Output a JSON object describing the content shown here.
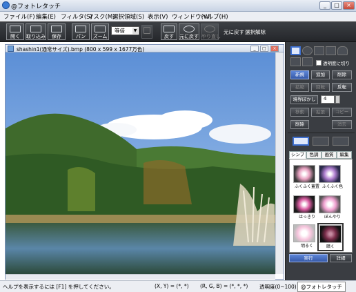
{
  "window": {
    "title": "@フォトレタッチ",
    "buttons": {
      "minimize": "_",
      "maximize": "□",
      "close": "×"
    }
  },
  "menubar": [
    "ファイル(F)",
    "編集(E)",
    "フィルタ(S)",
    "マスク(M)",
    "選択領域(S)",
    "表示(V)",
    "ウィンドウ(W)",
    "ヘルプ(H)"
  ],
  "toolbar": {
    "open": "開く",
    "import": "取り込み",
    "save": "保存",
    "pan": "パン",
    "zoom": "ズーム",
    "zoom_value": "等倍",
    "redo_fill": "戻す",
    "undo_redo": "元に戻す",
    "redo": "やり直し",
    "undo_text": "元に戻す",
    "deselect_text": "選択解除"
  },
  "canvas": {
    "title": "shashin1(通常サイズ).bmp (800 x 599 x 1677万色)"
  },
  "panel": {
    "transparency_label": "透明度に切り",
    "new_selection": "新規",
    "add_selection": "追加",
    "remove_selection": "削除",
    "btn_scale": "拡縮",
    "btn_rotate": "回転",
    "btn_invert": "反転",
    "feather_label": "境界ぼかし",
    "feather_value": "4",
    "btn_move": "移動",
    "btn_expand": "拡張",
    "btn_copy": "コピー",
    "btn_delete": "削除",
    "btn_clear": "消去"
  },
  "filters": {
    "tabs": [
      "シンプル",
      "色調",
      "画質",
      "編集"
    ],
    "items": [
      {
        "label": "ふくふく蓋置",
        "hue": "#e8a0c0"
      },
      {
        "label": "ふくふく色",
        "hue": "#b07fd0"
      },
      {
        "label": "はっきり",
        "hue": "#d85aa0"
      },
      {
        "label": "ぼんやり",
        "hue": "#f0a0d0"
      },
      {
        "label": "明るく",
        "hue": "#f7c5dd"
      },
      {
        "label": "暗く",
        "hue": "#7a2d4a"
      }
    ],
    "run_button": "実行",
    "detail_button": "詳細"
  },
  "statusbar": {
    "help_text": "ヘルプを表示するには [F1] を押してください。",
    "coords": "(X, Y) = (*, *)",
    "rgb": "(R, G, B) = (*, *, *)",
    "transparency": "透明度(0~100)",
    "app": "@フォトレタッチ"
  }
}
